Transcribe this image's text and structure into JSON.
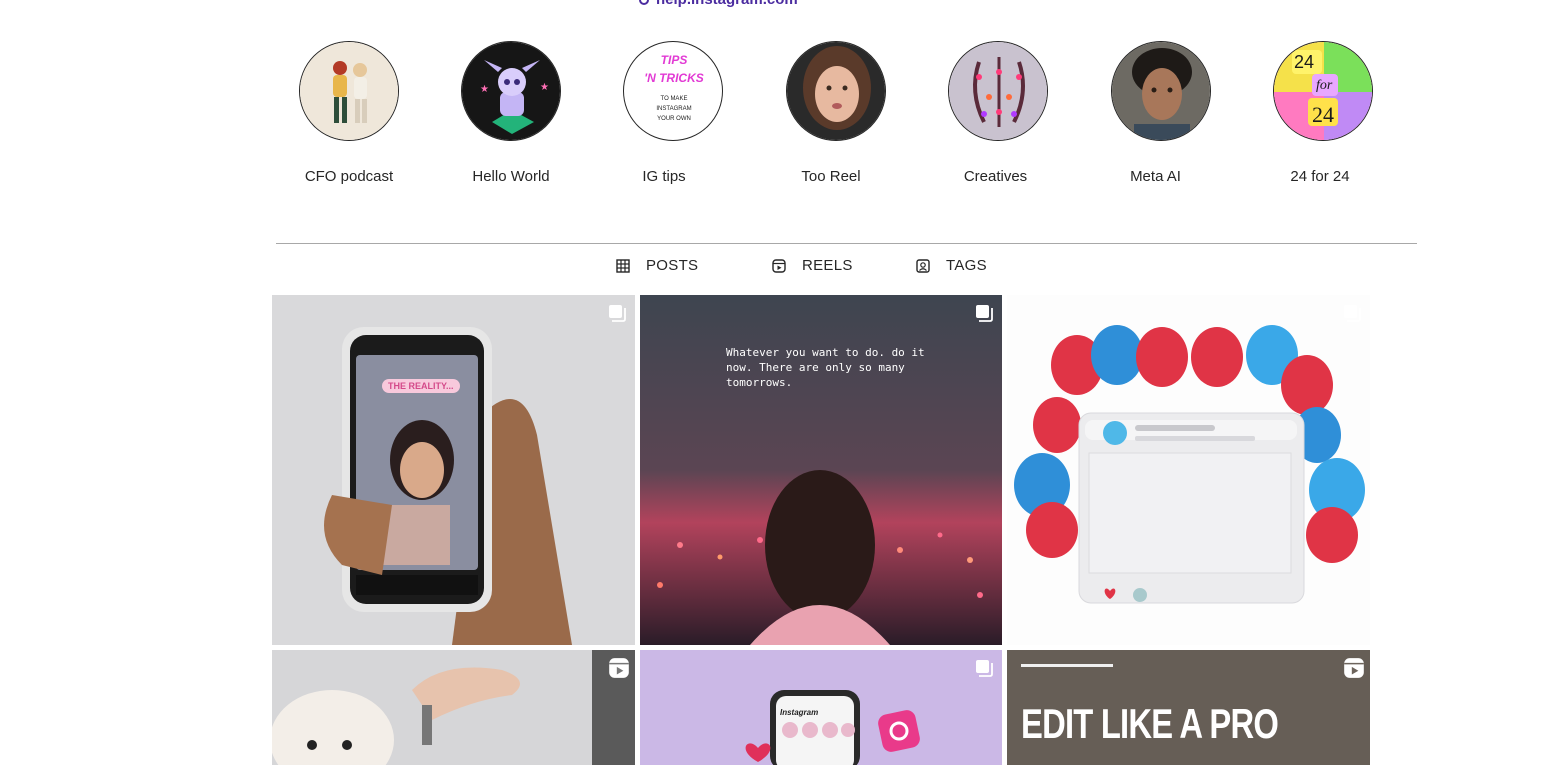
{
  "header": {
    "link_text": "help.instagram.com",
    "link_icon": "link-icon"
  },
  "highlights": [
    {
      "label": "CFO podcast"
    },
    {
      "label": "Hello World"
    },
    {
      "label": "IG tips"
    },
    {
      "label": "Too Reel"
    },
    {
      "label": "Creatives"
    },
    {
      "label": "Meta AI"
    },
    {
      "label": "24 for 24"
    }
  ],
  "highlight_art": {
    "ig_tips_title": "TIPS 'N TRICKS",
    "ig_tips_sub1": "TO MAKE",
    "ig_tips_sub2": "INSTAGRAM",
    "ig_tips_sub3": "YOUR OWN",
    "tf_24_a": "24",
    "tf_for": "for",
    "tf_24_b": "24"
  },
  "tabs": [
    {
      "label": "POSTS",
      "icon": "grid-icon"
    },
    {
      "label": "REELS",
      "icon": "reels-icon"
    },
    {
      "label": "TAGS",
      "icon": "tagged-icon"
    }
  ],
  "posts": [
    {
      "type": "carousel",
      "badge": "carousel-icon",
      "overlay": "THE REALITY..."
    },
    {
      "type": "carousel",
      "badge": "carousel-icon",
      "overlay": "Whatever you want to do. do it now. There are only so many tomorrows."
    },
    {
      "type": "carousel",
      "badge": "carousel-icon",
      "overlay": ""
    },
    {
      "type": "reel",
      "badge": "reels-icon",
      "overlay": ""
    },
    {
      "type": "carousel",
      "badge": "carousel-icon",
      "overlay": "Instagram"
    },
    {
      "type": "reel",
      "badge": "reels-icon",
      "overlay": "EDIT LIKE A PRO"
    }
  ],
  "colors": {
    "link": "#4b2ca0",
    "divider": "#a8a8a8",
    "text": "#262626"
  }
}
